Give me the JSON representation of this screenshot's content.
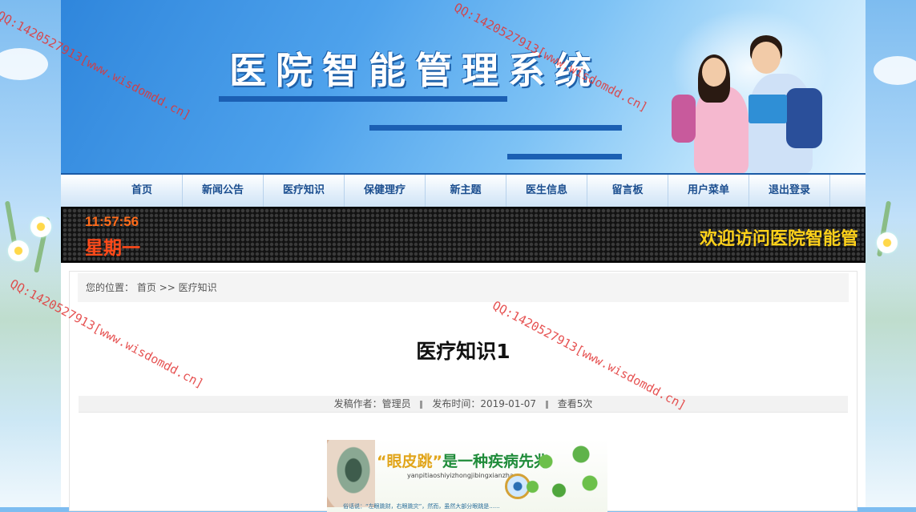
{
  "banner": {
    "title": "医院智能管理系统"
  },
  "nav": {
    "items": [
      "首页",
      "新闻公告",
      "医疗知识",
      "保健理疗",
      "新主题",
      "医生信息",
      "留言板",
      "用户菜单",
      "退出登录"
    ]
  },
  "ticker": {
    "time": "11:57:56",
    "weekday": "星期一",
    "marquee": "欢迎访问医院智能管"
  },
  "breadcrumb": {
    "prefix": "您的位置：",
    "home": "首页",
    "sep": ">>",
    "current": "医疗知识"
  },
  "article": {
    "title": "医疗知识1",
    "author": "发稿作者：管理员",
    "date": "发布时间：2019-01-07",
    "views": "查看5次",
    "image_caption_quote": "“眼皮跳”",
    "image_caption_rest": "是一种疾病先兆",
    "image_pinyin": "yanpitiaoshiyizhongjibingxianzhao",
    "image_footer": "俗话说：“左眼跳财，右眼跳灾”，然而，虽然大部分眼跳是......"
  },
  "watermark": {
    "text": "QQ:1420527913[www.wisdomdd.cn]",
    "color": "#e23535"
  },
  "colors": {
    "nav_text": "#1b4e8f",
    "ticker_time": "#ff6b1a",
    "ticker_marquee": "#ffd21a"
  }
}
